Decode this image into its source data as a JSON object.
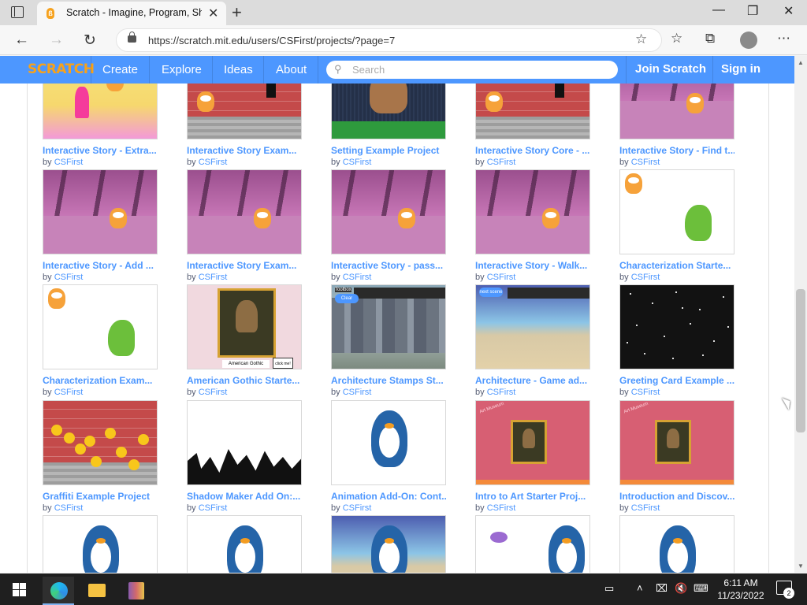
{
  "browser": {
    "tab_title": "Scratch - Imagine, Program, Sha",
    "tab_close": "✕",
    "new_tab": "+",
    "url": "https://scratch.mit.edu/users/CSFirst/projects/?page=7",
    "minimize": "—",
    "restore": "❐",
    "close": "✕"
  },
  "site": {
    "logo": "SCRATCH",
    "nav": [
      "Create",
      "Explore",
      "Ideas",
      "About"
    ],
    "search_placeholder": "Search",
    "join": "Join Scratch",
    "signin": "Sign in"
  },
  "projects": [
    {
      "title": "Interactive Story - Extra...",
      "by": "by",
      "author": "CSFirst",
      "thumb": "room"
    },
    {
      "title": "Interactive Story Exam...",
      "by": "by",
      "author": "CSFirst",
      "thumb": "bricks"
    },
    {
      "title": "Setting Example Project",
      "by": "by",
      "author": "CSFirst",
      "thumb": "rain"
    },
    {
      "title": "Interactive Story Core - ...",
      "by": "by",
      "author": "CSFirst",
      "thumb": "bricks"
    },
    {
      "title": "Interactive Story - Find t...",
      "by": "by",
      "author": "CSFirst",
      "thumb": "purple"
    },
    {
      "title": "Interactive Story - Add ...",
      "by": "by",
      "author": "CSFirst",
      "thumb": "purple"
    },
    {
      "title": "Interactive Story Exam...",
      "by": "by",
      "author": "CSFirst",
      "thumb": "purple"
    },
    {
      "title": "Interactive Story - pass...",
      "by": "by",
      "author": "CSFirst",
      "thumb": "purple"
    },
    {
      "title": "Interactive Story - Walk...",
      "by": "by",
      "author": "CSFirst",
      "thumb": "purple"
    },
    {
      "title": "Characterization Starte...",
      "by": "by",
      "author": "CSFirst",
      "thumb": "dino"
    },
    {
      "title": "Characterization Exam...",
      "by": "by",
      "author": "CSFirst",
      "thumb": "dino"
    },
    {
      "title": "American Gothic Starte...",
      "by": "by",
      "author": "CSFirst",
      "thumb": "gothic"
    },
    {
      "title": "Architecture Stamps St...",
      "by": "by",
      "author": "CSFirst",
      "thumb": "city"
    },
    {
      "title": "Architecture - Game ad...",
      "by": "by",
      "author": "CSFirst",
      "thumb": "beachstrip"
    },
    {
      "title": "Greeting Card Example ...",
      "by": "by",
      "author": "CSFirst",
      "thumb": "space"
    },
    {
      "title": "Graffiti Example Project",
      "by": "by",
      "author": "CSFirst",
      "thumb": "graffiti"
    },
    {
      "title": "Shadow Maker Add On:...",
      "by": "by",
      "author": "CSFirst",
      "thumb": "shadow"
    },
    {
      "title": "Animation Add-On: Cont...",
      "by": "by",
      "author": "CSFirst",
      "thumb": "penguin"
    },
    {
      "title": "Intro to Art Starter Proj...",
      "by": "by",
      "author": "CSFirst",
      "thumb": "mona"
    },
    {
      "title": "Introduction and Discov...",
      "by": "by",
      "author": "CSFirst",
      "thumb": "mona"
    },
    {
      "title": "",
      "by": "",
      "author": "",
      "thumb": "penguin"
    },
    {
      "title": "",
      "by": "",
      "author": "",
      "thumb": "penguin"
    },
    {
      "title": "",
      "by": "",
      "author": "",
      "thumb": "beachpenguin"
    },
    {
      "title": "",
      "by": "",
      "author": "",
      "thumb": "penguinfish"
    },
    {
      "title": "",
      "by": "",
      "author": "",
      "thumb": "penguin"
    }
  ],
  "thumb_text": {
    "gothic_button": "click me!",
    "gothic_caption": "American Gothic",
    "city_label": "Toolbox",
    "city_button": "Clear",
    "beach_button": "next scene",
    "mona_caption": "Art Museum"
  },
  "taskbar": {
    "time": "6:11 AM",
    "date": "11/23/2022",
    "notifications": "2"
  }
}
